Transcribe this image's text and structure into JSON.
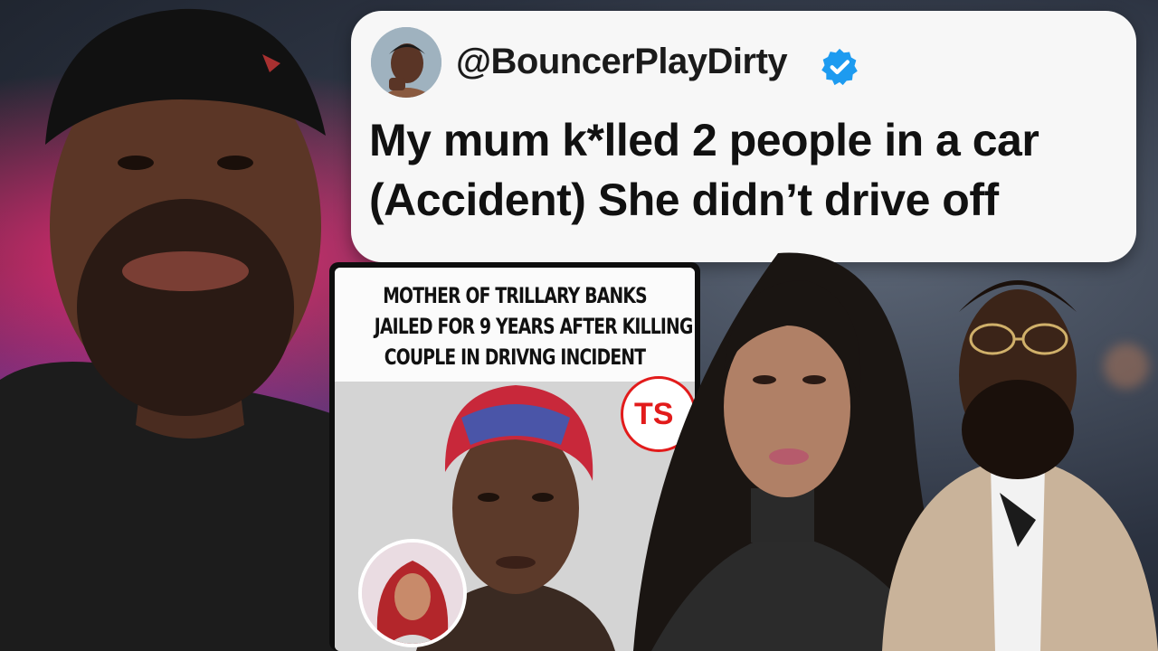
{
  "tweet": {
    "handle": "@BouncerPlayDirty",
    "line1": "My mum k*lled 2 people in a car",
    "line2": "(Accident) She didn’t drive off"
  },
  "news": {
    "line1": "MOTHER OF TRILLARY BANKS",
    "line2": "JAILED FOR 9 YEARS AFTER KILLING",
    "line3": "COUPLE IN DRIVNG INCIDENT",
    "logo_text": "TS"
  },
  "colors": {
    "verified_blue": "#1d9bf0",
    "logo_red": "#e21b1b",
    "tweet_bg": "#f7f7f7"
  }
}
